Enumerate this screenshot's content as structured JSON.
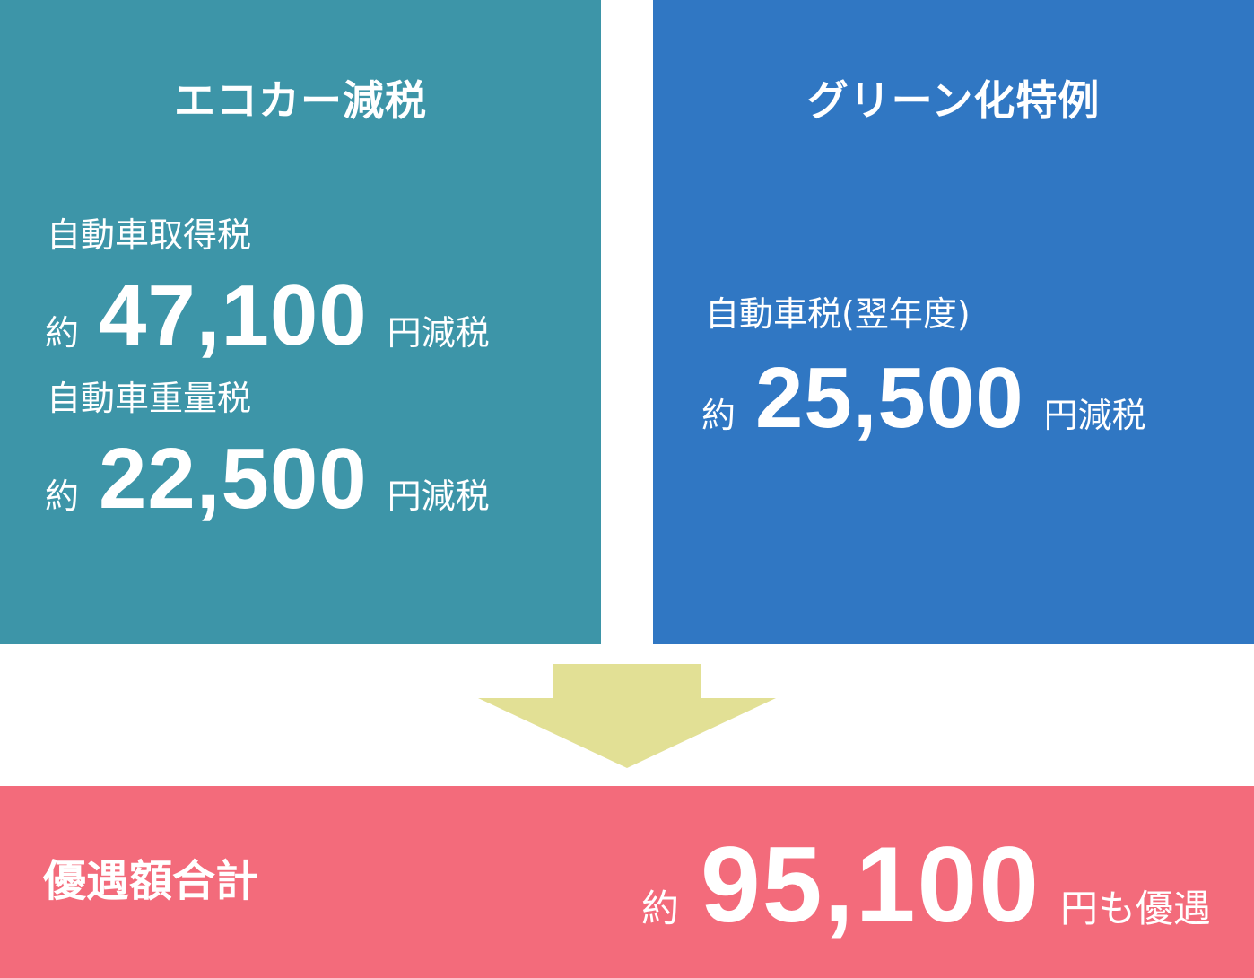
{
  "left_panel": {
    "title": "エコカー減税",
    "items": [
      {
        "label": "自動車取得税",
        "prefix": "約",
        "amount": "47,100",
        "suffix": "円減税"
      },
      {
        "label": "自動車重量税",
        "prefix": "約",
        "amount": "22,500",
        "suffix": "円減税"
      }
    ],
    "color": "#3d95a8"
  },
  "right_panel": {
    "title": "グリーン化特例",
    "items": [
      {
        "label": "自動車税(翌年度)",
        "prefix": "約",
        "amount": "25,500",
        "suffix": "円減税"
      }
    ],
    "color": "#3077c3"
  },
  "arrow": {
    "color": "#e2e095",
    "icon": "arrow-down-icon"
  },
  "total": {
    "label": "優遇額合計",
    "prefix": "約",
    "amount": "95,100",
    "suffix": "円も優遇",
    "color": "#f36b7b"
  }
}
